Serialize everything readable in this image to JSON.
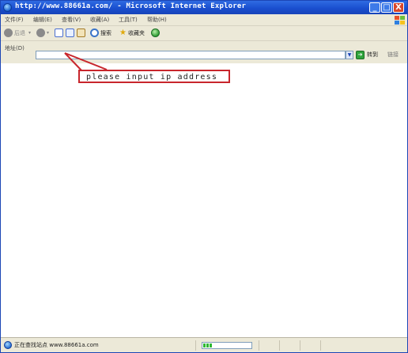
{
  "window": {
    "title": "http://www.88661a.com/ - Microsoft Internet Explorer",
    "buttons": {
      "minimize": "_",
      "maximize": "□",
      "close": "X"
    }
  },
  "menu": [
    "文件(F)",
    "编辑(E)",
    "查看(V)",
    "收藏(A)",
    "工具(T)",
    "帮助(H)"
  ],
  "toolbar": {
    "back_label": "后退",
    "search_label": "搜索",
    "favorites_label": "收藏夹"
  },
  "address": {
    "label": "地址(D)",
    "value": "",
    "go_label": "转到",
    "links_label": "链接"
  },
  "callout": {
    "text": "please input ip address",
    "color": "#c8262c"
  },
  "status": {
    "text": "正在查找站点 www.88661a.com",
    "progress": 0.2
  },
  "colors": {
    "titlebar": "#1a4fcf",
    "chrome": "#ece9d8",
    "close_button": "#d9472b"
  }
}
